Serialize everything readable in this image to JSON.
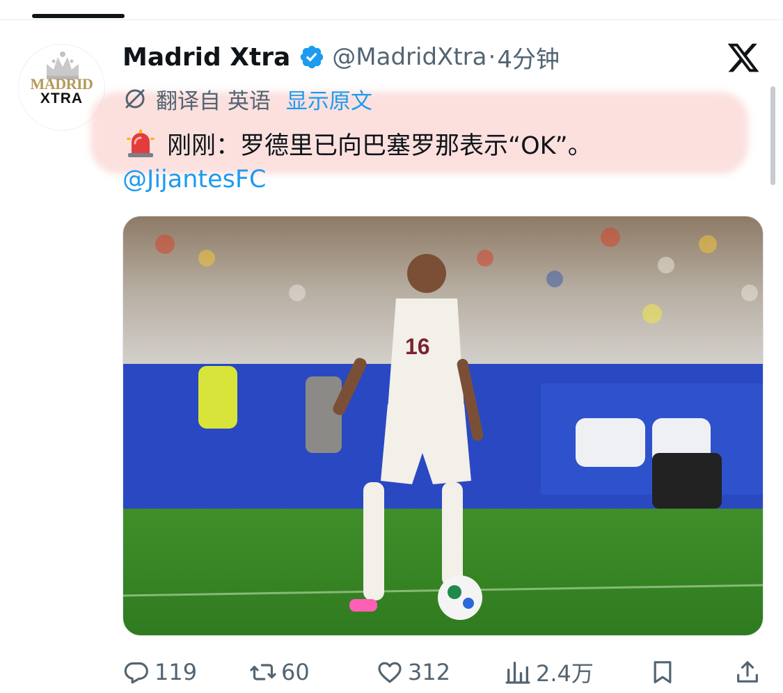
{
  "tweet": {
    "author": {
      "display_name": "Madrid Xtra",
      "handle": "@MadridXtra",
      "avatar_line1": "MADRID",
      "avatar_line2": "XTRA"
    },
    "separator": "·",
    "time": "4分钟",
    "translation": {
      "translated_from": "翻译自 英语",
      "show_original": "显示原文"
    },
    "text": "刚刚：罗德里已向巴塞罗那表示“OK”。",
    "mention": "@JijantesFC",
    "media_icon": "photo",
    "actions": {
      "reply_count": "119",
      "repost_count": "60",
      "like_count": "312",
      "view_count": "2.4万"
    }
  },
  "colors": {
    "link": "#1d9bf0",
    "secondary_text": "#536471",
    "verified": "#1d9bf0",
    "highlight": "#f6bab6"
  },
  "icons": [
    "verified-badge-icon",
    "x-logo-icon",
    "translate-icon",
    "siren-icon",
    "reply-icon",
    "repost-icon",
    "like-icon",
    "views-icon",
    "bookmark-icon",
    "share-icon"
  ]
}
